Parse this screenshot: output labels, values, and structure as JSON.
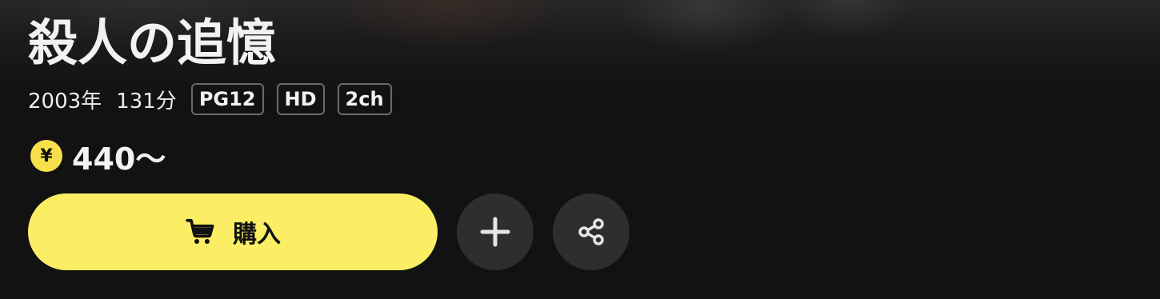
{
  "title": "殺人の追憶",
  "meta": {
    "year": "2003年",
    "duration": "131分",
    "badges": [
      "PG12",
      "HD",
      "2ch"
    ]
  },
  "price": {
    "currency_symbol": "¥",
    "amount": "440〜"
  },
  "actions": {
    "buy_label": "購入",
    "buy_icon": "cart-icon",
    "add_icon": "plus-icon",
    "share_icon": "share-icon"
  },
  "colors": {
    "background": "#121212",
    "accent_yellow": "#fcee64",
    "coin_yellow": "#f7e04b",
    "round_button": "#2e2e2e"
  }
}
